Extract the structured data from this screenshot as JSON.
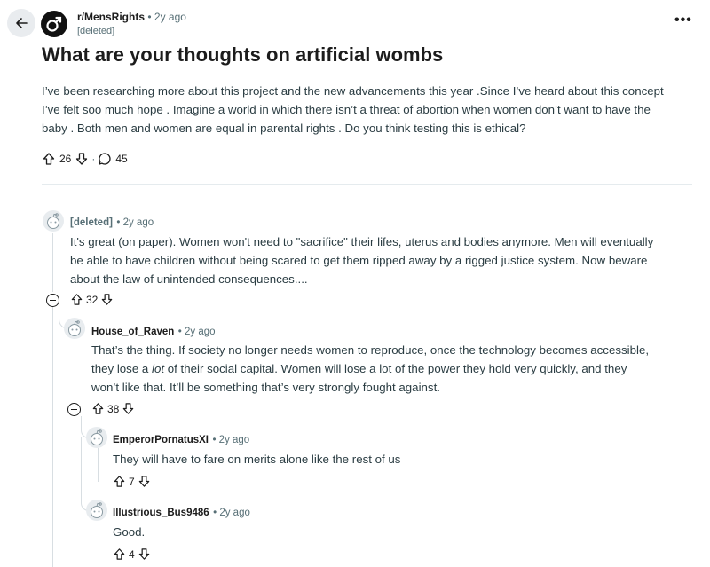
{
  "post": {
    "subreddit": "r/MensRights",
    "time": "• 2y ago",
    "author": "[deleted]",
    "title": "What are your thoughts on artificial wombs",
    "body_lines": [
      "I’ve been researching more about this project and the new advancements this year .Since I’ve heard about this concept",
      "I’ve felt soo much hope . Imagine a world in which there isn’t a threat of abortion when women don’t want to have the",
      "baby . Both men and women are equal in parental rights . Do you think testing this is ethical?"
    ],
    "upvotes": "26",
    "separator": "·",
    "comments": "45",
    "more": "•••"
  },
  "comments": [
    {
      "author": "[deleted]",
      "time": "• 2y ago",
      "lines": [
        "It's great (on paper). Women won't need to \"sacrifice\" their lifes, uterus and bodies anymore. Men will eventually",
        "be able to have children without being scared to get them ripped away by a rigged justice system. Now beware",
        "about the law of unintended consequences...."
      ],
      "votes": "32"
    },
    {
      "author": "House_of_Raven",
      "time": "• 2y ago",
      "line1_pre": "That’s the thing. If society no longer needs women to reproduce, once the technology becomes accessible,",
      "line2_pre": "they lose a ",
      "line2_em": "lot",
      "line2_post": " of their social capital. Women will lose a lot of the power they hold very quickly, and they",
      "line3": "won’t like that. It’ll be something that’s very strongly fought against.",
      "votes": "38"
    },
    {
      "author": "EmperorPornatusXI",
      "time": "• 2y ago",
      "text": "They will have to fare on merits alone like the rest of us",
      "votes": "7"
    },
    {
      "author": "Illustrious_Bus9486",
      "time": "• 2y ago",
      "text": "Good.",
      "votes": "4"
    }
  ],
  "icons": {
    "back": "arrow-left-icon",
    "subreddit": "mars-symbol-icon",
    "avatar": "snoo-avatar-icon",
    "upvote": "upvote-arrow-icon",
    "downvote": "downvote-arrow-icon",
    "comment": "comment-bubble-icon",
    "collapse": "collapse-minus-icon"
  }
}
